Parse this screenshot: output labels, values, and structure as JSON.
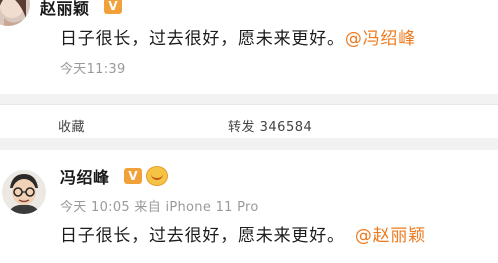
{
  "post1": {
    "username": "赵丽颖",
    "vip_badge": "V",
    "text_main": "日子很长，过去很好，愿未来更好。",
    "mention": "@冯绍峰",
    "time": "今天11:39"
  },
  "actions": {
    "favorite_label": "收藏",
    "repost_label": "转发 346584"
  },
  "post2": {
    "username": "冯绍峰",
    "vip_badge": "V",
    "meta": "今天 10:05 来自 iPhone 11 Pro",
    "text_main": "日子很长，过去很好，愿未来更好。",
    "mention": "@赵丽颖"
  },
  "colors": {
    "mention": "#ef7a1e",
    "vip": "#f2a03a",
    "meta_text": "#9a9a9a",
    "separator": "#f2f2f2"
  }
}
